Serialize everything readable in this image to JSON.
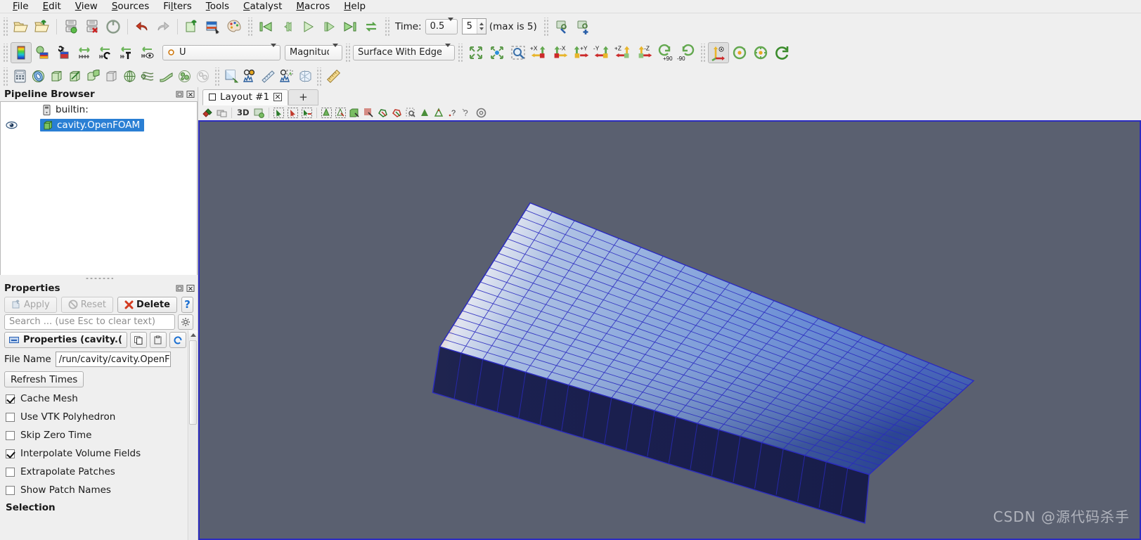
{
  "app": {
    "title": "ParaView"
  },
  "menubar": {
    "items": [
      {
        "label": "File",
        "mnemonic": "F"
      },
      {
        "label": "Edit",
        "mnemonic": "E"
      },
      {
        "label": "View",
        "mnemonic": "V"
      },
      {
        "label": "Sources",
        "mnemonic": "S"
      },
      {
        "label": "Filters",
        "mnemonic": "l"
      },
      {
        "label": "Tools",
        "mnemonic": "T"
      },
      {
        "label": "Catalyst",
        "mnemonic": "C"
      },
      {
        "label": "Macros",
        "mnemonic": "M"
      },
      {
        "label": "Help",
        "mnemonic": "H"
      }
    ]
  },
  "main_toolbar": {
    "icons": [
      "open-file-icon",
      "save-data-icon",
      "connect-server-icon",
      "disconnect-server-icon",
      "reload-state-icon",
      "undo-icon",
      "redo-icon",
      "change-input-icon",
      "screenshot-icon",
      "color-palette-icon"
    ]
  },
  "vcr_toolbar": {
    "icons": [
      "first-frame-icon",
      "previous-frame-icon",
      "play-icon",
      "next-frame-icon",
      "last-frame-icon",
      "loop-icon"
    ],
    "time_label": "Time:",
    "time_value": "0.5",
    "frame_value": "5",
    "max_label": "(max is 5)",
    "extra_icons": [
      "edit-view-icon",
      "add-view-icon"
    ]
  },
  "representation_toolbar": {
    "icons": [
      "color-map-editor-icon",
      "rescale-data-range-icon",
      "rescale-custom-icon",
      "rescale-to-data-icon",
      "rescale-to-temporal-icon",
      "rescale-visible-icon",
      "rescale-over-time-icon"
    ],
    "array": "U",
    "array_icon": "point-data-icon",
    "component": "Magnitude",
    "representation": "Surface With Edge"
  },
  "camera_toolbar": {
    "icons": [
      "reset-camera-icon",
      "zoom-to-data-icon",
      "zoom-to-box-icon"
    ],
    "axis_buttons": [
      "+X",
      "-X",
      "+Y",
      "-Y",
      "+Z",
      "-Z"
    ],
    "rotate_plus": "+90",
    "rotate_minus": "-90",
    "extra_icons": [
      "show-center-axes-icon",
      "reset-center-icon",
      "pick-center-icon",
      "rotate-icon"
    ]
  },
  "filters_toolbar": {
    "icons": [
      "calculator-icon",
      "contour-icon",
      "clip-icon",
      "slice-icon",
      "threshold-icon",
      "extract-subset-icon",
      "glyph-icon",
      "stream-tracer-icon",
      "warp-icon",
      "group-datasets-icon",
      "extract-level-icon",
      "plot-over-line-icon",
      "plot-selection-icon",
      "plot-data-over-time-icon",
      "extract-selection-icon",
      "ruler-icon"
    ]
  },
  "pipeline_browser": {
    "title": "Pipeline Browser",
    "window_buttons": [
      "float-icon",
      "close-icon"
    ],
    "items": [
      {
        "label": "builtin:",
        "icon": "server-icon",
        "selected": false,
        "visible": false,
        "indent": 0
      },
      {
        "label": "cavity.OpenFOAM",
        "icon": "geometry-icon",
        "selected": true,
        "visible": true,
        "indent": 1
      }
    ]
  },
  "properties_panel": {
    "title": "Properties",
    "window_buttons": [
      "float-icon",
      "close-icon"
    ],
    "apply_label": "Apply",
    "apply_enabled": false,
    "reset_label": "Reset",
    "reset_enabled": false,
    "delete_label": "Delete",
    "delete_enabled": true,
    "help_label": "?",
    "search_placeholder": "Search ... (use Esc to clear text)",
    "search_value": "",
    "gear_icon": "advanced-properties-icon",
    "section_header": "Properties (cavity.OpenFOAM)",
    "section_header_display": "Properties (cavity.(",
    "header_buttons": [
      "copy-icon",
      "paste-icon",
      "restore-defaults-icon"
    ],
    "file_name_label": "File Name",
    "file_name_value": "/run/cavity/cavity.OpenFOAM",
    "file_name_display": "/run/cavity/cavity.OpenFOAM",
    "refresh_times_label": "Refresh Times",
    "checkboxes": [
      {
        "label": "Cache Mesh",
        "checked": true
      },
      {
        "label": "Use VTK Polyhedron",
        "checked": false
      },
      {
        "label": "Skip Zero Time",
        "checked": false
      },
      {
        "label": "Interpolate Volume Fields",
        "checked": true
      },
      {
        "label": "Extrapolate Patches",
        "checked": false
      },
      {
        "label": "Show Patch Names",
        "checked": false
      }
    ],
    "next_section": "Selection"
  },
  "layout": {
    "tab_label": "Layout #1",
    "add_tab_label": "+",
    "view_toolbar_icons": [
      "interaction-mode-icon",
      "camera-undo-icon",
      "3d-toggle-icon",
      "capture-icon",
      "select-cells-icon",
      "select-points-icon",
      "select-cells-through-icon",
      "select-points-through-icon",
      "select-block-icon",
      "frustum-cells-icon",
      "frustum-points-icon",
      "select-polygon-cells-icon",
      "select-polygon-points-icon",
      "interactive-select-icon",
      "hover-cells-icon",
      "hover-points-icon",
      "query-cells-icon",
      "query-points-icon",
      "clear-selection-icon"
    ],
    "view_label_3d": "3D"
  },
  "render_view": {
    "background_color": "#5a6070",
    "border_color": "#2b2bbf",
    "mesh": {
      "name": "cavity-mesh",
      "grid_cols": 20,
      "grid_rows": 20,
      "edge_color": "#2323c8",
      "colormap": "cool-to-warm",
      "low_color": "#1c1c70",
      "high_color": "#8a0b0b",
      "side_face_color": "#8f0e0e",
      "front_face_color": "#1b2050"
    },
    "watermark": "CSDN @源代码杀手"
  }
}
